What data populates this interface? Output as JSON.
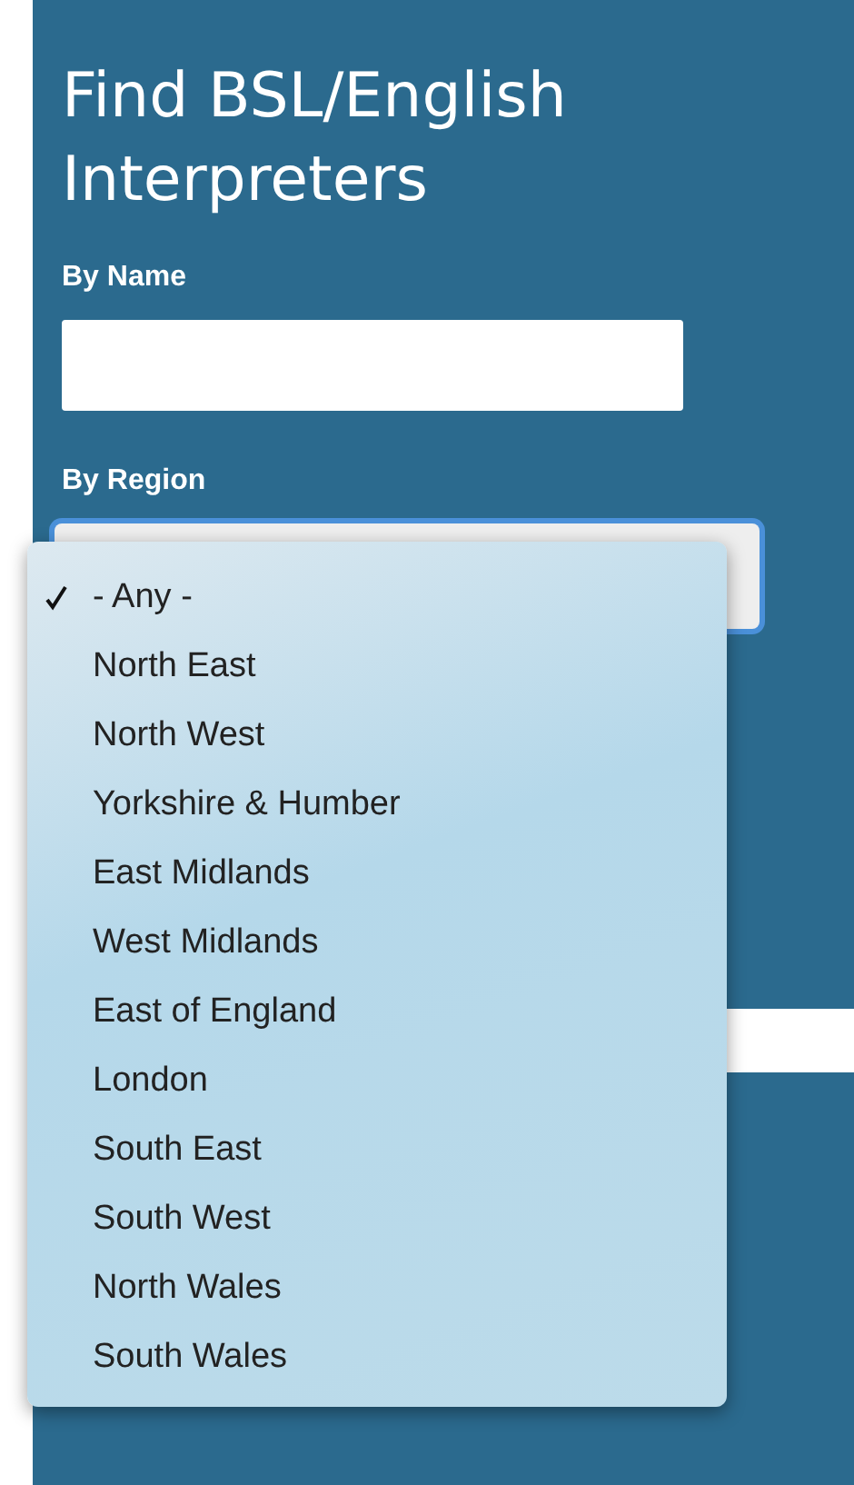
{
  "title": "Find BSL/English Interpreters",
  "name_label": "By Name",
  "region_label": "By Region",
  "region_options": [
    {
      "label": "- Any -",
      "selected": true
    },
    {
      "label": "North East",
      "selected": false
    },
    {
      "label": "North West",
      "selected": false
    },
    {
      "label": "Yorkshire & Humber",
      "selected": false
    },
    {
      "label": "East Midlands",
      "selected": false
    },
    {
      "label": "West Midlands",
      "selected": false
    },
    {
      "label": "East of England",
      "selected": false
    },
    {
      "label": "London",
      "selected": false
    },
    {
      "label": "South East",
      "selected": false
    },
    {
      "label": "South West",
      "selected": false
    },
    {
      "label": "North Wales",
      "selected": false
    },
    {
      "label": "South Wales",
      "selected": false
    }
  ]
}
